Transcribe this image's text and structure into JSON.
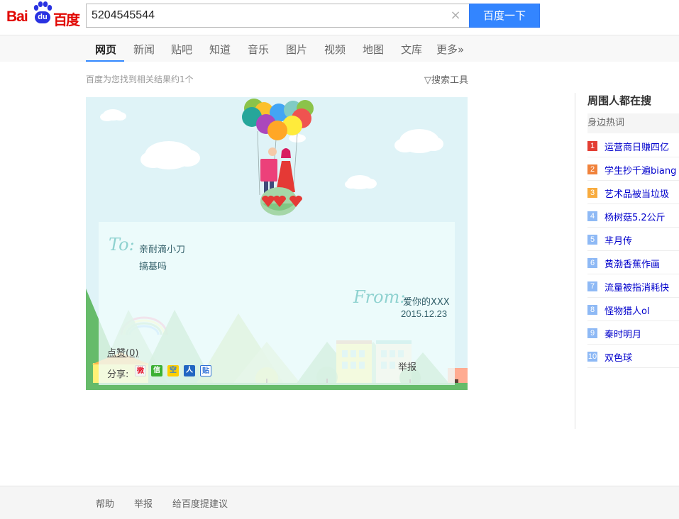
{
  "logo": {
    "latin": "Bai",
    "du": "du",
    "chinese": "百度"
  },
  "search": {
    "query": "5204545544",
    "button_label": "百度一下",
    "clear_symbol": "×"
  },
  "nav": {
    "tabs": [
      {
        "label": "网页",
        "active": true
      },
      {
        "label": "新闻",
        "active": false
      },
      {
        "label": "贴吧",
        "active": false
      },
      {
        "label": "知道",
        "active": false
      },
      {
        "label": "音乐",
        "active": false
      },
      {
        "label": "图片",
        "active": false
      },
      {
        "label": "视频",
        "active": false
      },
      {
        "label": "地图",
        "active": false
      },
      {
        "label": "文库",
        "active": false
      },
      {
        "label": "更多»",
        "active": false
      }
    ]
  },
  "results": {
    "count_text": "百度为您找到相关结果约1个",
    "tools_label": "▽搜索工具"
  },
  "card": {
    "to_label": "To:",
    "to_name": "亲耐滴小刀",
    "message": "搞基吗",
    "from_label": "From:",
    "from_name": "爱你的XXX",
    "date": "2015.12.23",
    "like_label": "点赞(0)",
    "share_label": "分享:",
    "share_icons": [
      "weibo-icon",
      "wechat-icon",
      "qzone-icon",
      "renren-icon",
      "tieba-icon"
    ],
    "share_glyphs": [
      "微",
      "信",
      "空",
      "人",
      "贴"
    ],
    "report_label": "举报"
  },
  "sidebar": {
    "title": "周围人都在搜",
    "subtitle": "身边热词",
    "items": [
      {
        "rank": "1",
        "text": "运营商日赚四亿",
        "color": "#e33e33"
      },
      {
        "rank": "2",
        "text": "学生抄千遍biang",
        "color": "#f0823b"
      },
      {
        "rank": "3",
        "text": "艺术品被当垃圾",
        "color": "#f8ab3e"
      },
      {
        "rank": "4",
        "text": "杨树菇5.2公斤",
        "color": "#8eb9f5"
      },
      {
        "rank": "5",
        "text": "芈月传",
        "color": "#8eb9f5"
      },
      {
        "rank": "6",
        "text": "黄渤香蕉作画",
        "color": "#8eb9f5"
      },
      {
        "rank": "7",
        "text": "流量被指消耗快",
        "color": "#8eb9f5"
      },
      {
        "rank": "8",
        "text": "怪物猎人ol",
        "color": "#8eb9f5"
      },
      {
        "rank": "9",
        "text": "秦时明月",
        "color": "#8eb9f5"
      },
      {
        "rank": "10",
        "text": "双色球",
        "color": "#8eb9f5"
      }
    ]
  },
  "footer": {
    "links": [
      "帮助",
      "举报",
      "给百度提建议"
    ]
  },
  "colors": {
    "accent": "#3385ff",
    "logo_red": "#e10601",
    "logo_blue": "#2932e1",
    "link": "#0000cc"
  }
}
